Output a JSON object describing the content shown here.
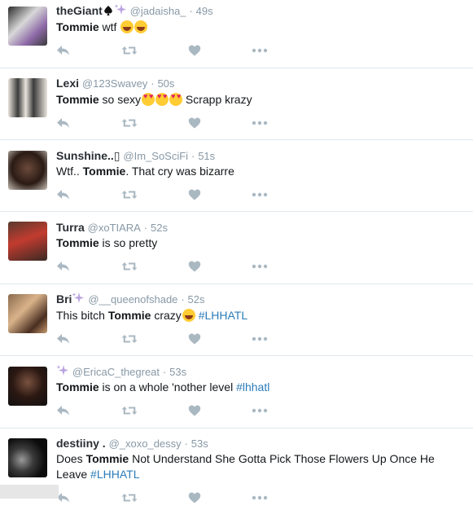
{
  "tweets": [
    {
      "name": "theGiant",
      "handle": "@jadaisha_",
      "time": "49s",
      "text_bold": "Tommie",
      "text_rest": " wtf",
      "emojis": [
        "face-with-tears-of-joy",
        "face-with-tears-of-joy"
      ],
      "badges": [
        "spade-icon",
        "sparkles-icon"
      ]
    },
    {
      "name": "Lexi",
      "handle": "@123Swavey",
      "time": "50s",
      "text_bold": "Tommie",
      "text_rest": " so sexy",
      "emojis": [
        "heart-eyes",
        "heart-eyes",
        "heart-eyes"
      ],
      "text_after": " Scrapp krazy"
    },
    {
      "name": "Sunshine..",
      "handle": "@Im_SoSciFi",
      "time": "51s",
      "text_pre": "Wtf.. ",
      "text_bold": "Tommie",
      "text_rest": ". That cry was bizarre"
    },
    {
      "name": "Turra",
      "handle": "@xoTIARA",
      "time": "52s",
      "text_bold": "Tommie",
      "text_rest": " is so pretty"
    },
    {
      "name": "Bri",
      "handle": "@__queenofshade",
      "time": "52s",
      "text_pre": "This bitch ",
      "text_bold": "Tommie",
      "text_rest": " crazy",
      "emojis": [
        "face-with-tears-of-joy"
      ],
      "hashtag": "#LHHATL"
    },
    {
      "name": "",
      "handle": "@EricaC_thegreat",
      "time": "53s",
      "text_bold": "Tommie",
      "text_rest": " is on a whole 'nother level ",
      "hashtag": "#lhhatl"
    },
    {
      "name": "destiiny .",
      "handle": "@_xoxo_dessy",
      "time": "53s",
      "text_pre": "Does ",
      "text_bold": "Tommie",
      "text_rest": " Not Understand She Gotta Pick Those Flowers Up Once He",
      "text_line2": "Leave ",
      "hashtag": "#LHHATL"
    }
  ],
  "separator": "·",
  "icons": [
    "reply-icon",
    "retweet-icon",
    "like-icon",
    "more-icon"
  ],
  "colors": {
    "name": "#292f33",
    "meta": "#8899a6",
    "hashtag": "#2b7bb9",
    "action": "#aab8c2",
    "divider": "#e1e8ed"
  }
}
